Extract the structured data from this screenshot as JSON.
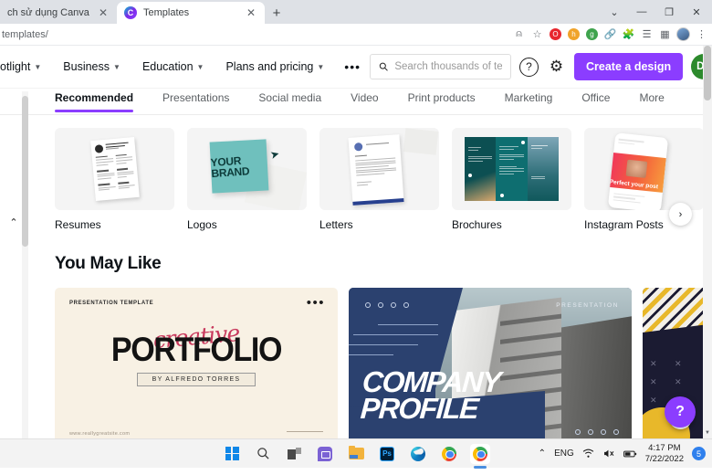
{
  "browser": {
    "tabs": [
      {
        "title": "ch sử dụng Canva trên điện th",
        "active": false,
        "favicon": ""
      },
      {
        "title": "Templates",
        "active": true,
        "favicon": "canva-icon"
      }
    ],
    "new_tab_label": "+",
    "window_controls": {
      "more": "⌄",
      "minimize": "—",
      "maximize": "❐",
      "close": "✕"
    },
    "address": "templates/",
    "toolbar_icons": [
      "share-icon",
      "bookmark-star-icon",
      "opera-extension-icon",
      "honey-extension-icon",
      "grammarly-extension-icon",
      "link-extension-icon",
      "extensions-puzzle-icon",
      "reading-list-icon",
      "side-panel-icon",
      "profile-avatar-icon",
      "chrome-menu-icon"
    ]
  },
  "canva": {
    "nav": [
      {
        "label": "otlight",
        "has_caret": true
      },
      {
        "label": "Business",
        "has_caret": true
      },
      {
        "label": "Education",
        "has_caret": true
      },
      {
        "label": "Plans and pricing",
        "has_caret": true
      }
    ],
    "nav_more": "•••",
    "search": {
      "placeholder": "Search thousands of templ",
      "value": ""
    },
    "help_label": "?",
    "settings_label": "gear",
    "create_button": "Create a design",
    "avatar_initials": "DP",
    "accent_color": "#8b3dff",
    "avatar_color": "#2d8a2d",
    "tabs": [
      {
        "label": "Recommended",
        "active": true
      },
      {
        "label": "Presentations",
        "active": false
      },
      {
        "label": "Social media",
        "active": false
      },
      {
        "label": "Video",
        "active": false
      },
      {
        "label": "Print products",
        "active": false
      },
      {
        "label": "Marketing",
        "active": false
      },
      {
        "label": "Office",
        "active": false
      },
      {
        "label": "More",
        "active": false
      }
    ],
    "categories": [
      {
        "label": "Resumes"
      },
      {
        "label": "Logos",
        "art_text": "YOUR BRAND"
      },
      {
        "label": "Letters"
      },
      {
        "label": "Brochures"
      },
      {
        "label": "Instagram Posts",
        "art_text": "Perfect your post"
      }
    ],
    "section_title": "You May Like",
    "templates": [
      {
        "name": "creative-portfolio",
        "kicker": "PRESENTATION TEMPLATE",
        "script": "creative",
        "title": "PORTFOLIO",
        "byline": "BY ALFREDO TORRES",
        "url": "www.reallygreatsite.com",
        "menu": "•••"
      },
      {
        "name": "company-profile",
        "kicker": "PRESENTATION",
        "title_line1": "COMPANY",
        "title_line2": "PROFILE"
      },
      {
        "name": "yellow-abstract",
        "title": ""
      }
    ],
    "carousel_next": "›",
    "collapse_chevron": "⌃",
    "help_fab": "?"
  },
  "taskbar": {
    "apps": [
      {
        "name": "start-button"
      },
      {
        "name": "search-button"
      },
      {
        "name": "task-view-button"
      },
      {
        "name": "chat-button"
      },
      {
        "name": "file-explorer-button"
      },
      {
        "name": "photoshop-button",
        "label": "Ps"
      },
      {
        "name": "edge-button"
      },
      {
        "name": "chrome-button"
      },
      {
        "name": "chrome-active-button"
      }
    ],
    "tray": {
      "overflow": "⌃",
      "language": "ENG",
      "network": "wifi-icon",
      "volume": "speaker-muted-icon",
      "battery": "battery-icon",
      "time": "4:17 PM",
      "date": "7/22/2022",
      "notification_count": "5"
    }
  }
}
